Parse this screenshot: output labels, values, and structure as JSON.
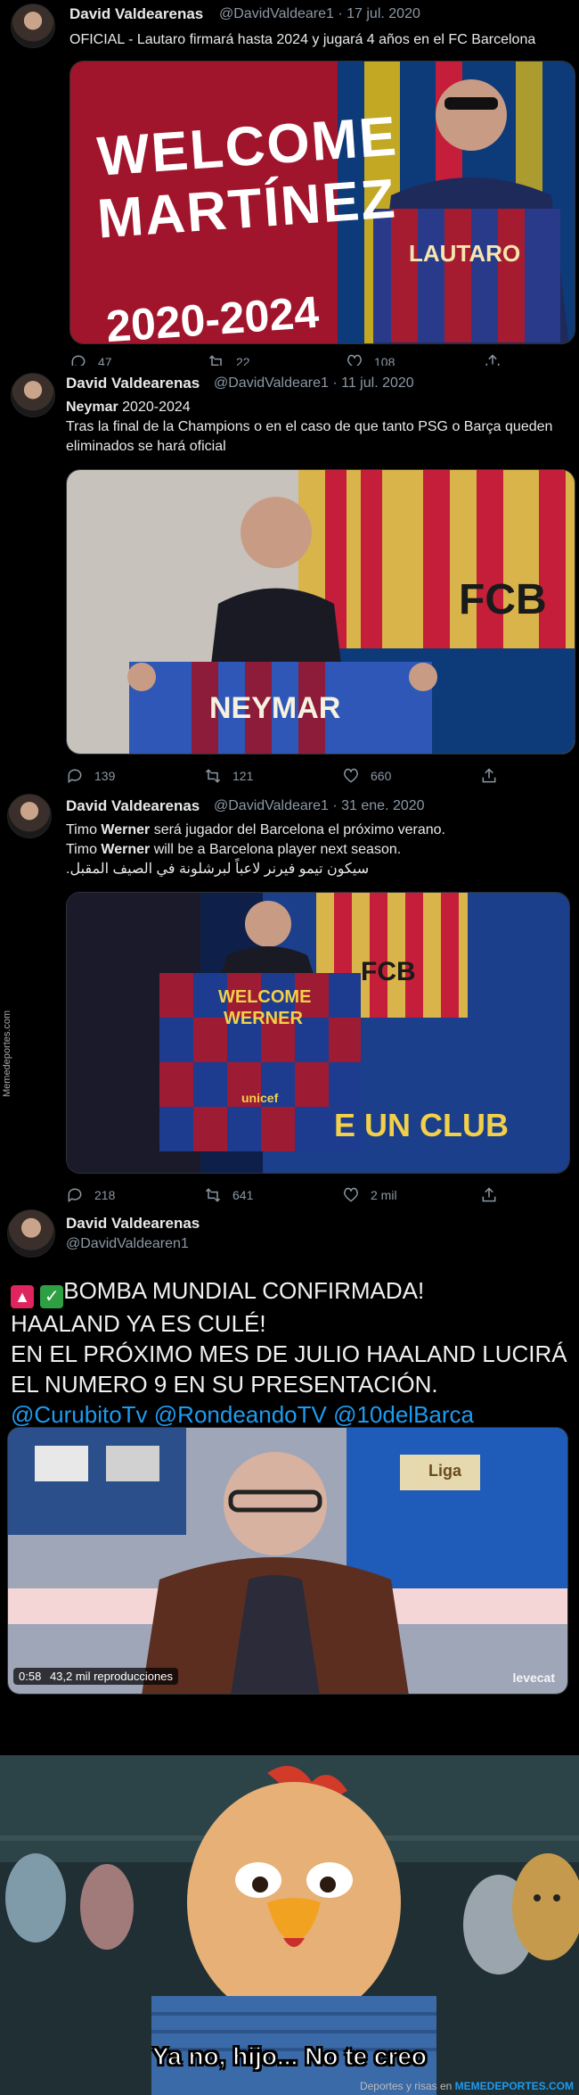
{
  "tweets": [
    {
      "name": "David Valdearenas",
      "handle_line": "@DavidValdeare1 · 17 jul. 2020",
      "text": "OFICIAL - Lautaro firmará hasta 2024 y jugará 4 años en el FC Barcelona",
      "image_text": {
        "welcome": "WELCOME",
        "surname": "MARTÍNEZ",
        "years": "2020-2024",
        "shirt": "LAUTARO"
      },
      "counts": {
        "replies": "47",
        "retweets": "22",
        "likes": "108"
      }
    },
    {
      "name": "David Valdearenas",
      "handle_line": "@DavidValdeare1 · 11 jul. 2020",
      "lead": "Neymar",
      "text1": " 2020-2024",
      "text2": "Tras la final de la Champions o en el caso de que tanto PSG o Barça queden eliminados se hará oficial",
      "image_text": {
        "shirt": "NEYMAR",
        "crest": "FCB"
      },
      "counts": {
        "replies": "139",
        "retweets": "121",
        "likes": "660"
      }
    },
    {
      "name": "David Valdearenas",
      "handle_line": "@DavidValdeare1 · 31 ene. 2020",
      "l1a": "Timo ",
      "l1b": "Werner",
      "l1c": " será jugador del Barcelona el próximo verano.",
      "l2a": "Timo ",
      "l2b": "Werner",
      "l2c": " will be a Barcelona player next season.",
      "l3": "سيكون تيمو فيرنر لاعباً لبرشلونة في الصيف المقبل.",
      "image_text": {
        "welcome": "WELCOME",
        "shirt": "WERNER",
        "sponsor": "unicef",
        "banner": "E UN CLUB",
        "crest": "FCB"
      },
      "counts": {
        "replies": "218",
        "retweets": "641",
        "likes": "2 mil"
      }
    },
    {
      "name": "David Valdearenas",
      "handle": "@DavidValdearen1",
      "line1": "BOMBA MUNDIAL CONFIRMADA!",
      "line2": "HAALAND YA ES CULÉ!",
      "line3": "EN EL PRÓXIMO MES DE JULIO HAALAND LUCIRÁ EL NUMERO 9 EN SU PRESENTACIÓN.",
      "mentions": "@CurubitoTv @RondeandoTV @10delBarca",
      "video": {
        "time": "0:58",
        "views": "43,2 mil reproducciones",
        "logo": "Liga",
        "brand": "levecat"
      }
    }
  ],
  "side_watermark": "Memedeportes.com",
  "meme": {
    "caption": "Ya no, hijo... No te creo"
  },
  "footer": {
    "prefix": "Deportes y risas en ",
    "brand": "MEMEDEPORTES.COM"
  },
  "colors": {
    "background": "#000000",
    "link": "#1d9bf0",
    "muted": "#8b98a5"
  }
}
